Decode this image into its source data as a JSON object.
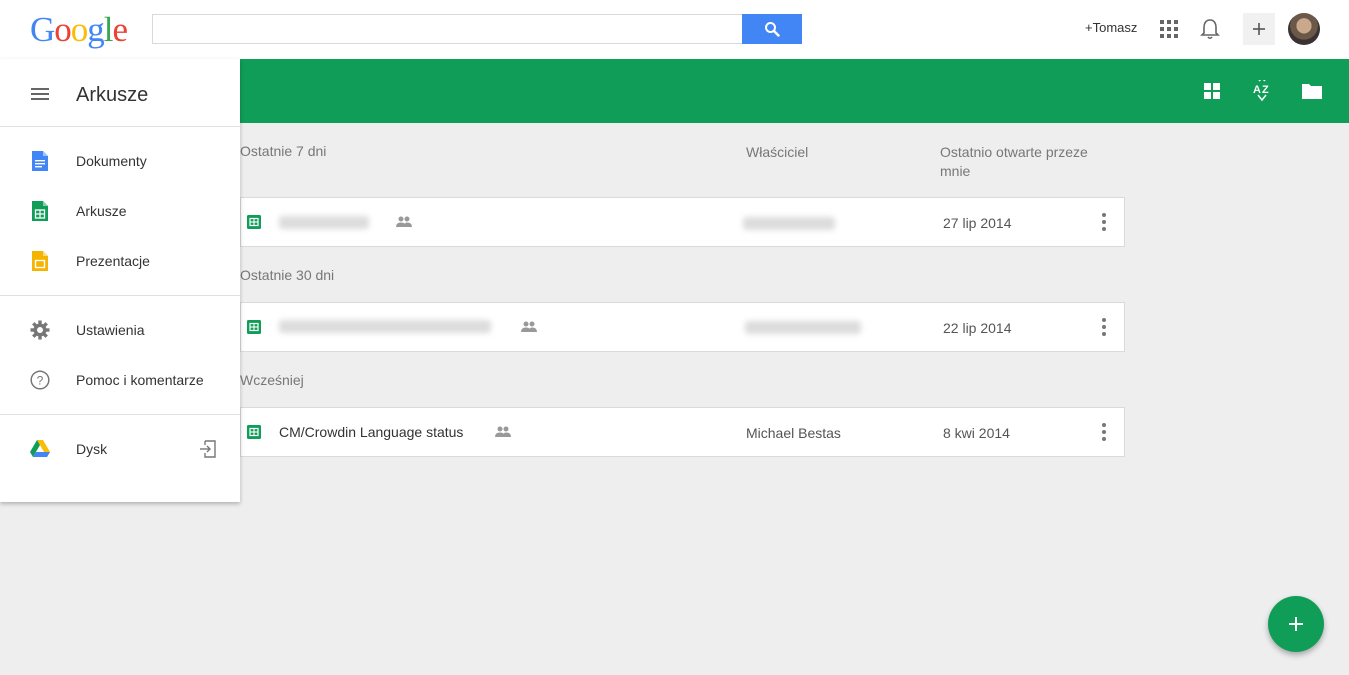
{
  "header": {
    "logo_letters": [
      "G",
      "o",
      "o",
      "g",
      "l",
      "e"
    ],
    "search_value": "",
    "user_link": "+Tomasz"
  },
  "drawer": {
    "title": "Arkusze",
    "apps": [
      {
        "label": "Dokumenty",
        "icon": "docs-icon",
        "color": "#4285f4"
      },
      {
        "label": "Arkusze",
        "icon": "sheets-icon",
        "color": "#0f9d58"
      },
      {
        "label": "Prezentacje",
        "icon": "slides-icon",
        "color": "#f4b400"
      }
    ],
    "settings": [
      {
        "label": "Ustawienia",
        "icon": "gear-icon"
      },
      {
        "label": "Pomoc i komentarze",
        "icon": "help-icon"
      }
    ],
    "drive": {
      "label": "Dysk",
      "icon": "drive-icon"
    }
  },
  "list": {
    "columns": {
      "owner": "Właściciel",
      "last_opened": "Ostatnio otwarte przeze mnie"
    },
    "groups": [
      {
        "title": "Ostatnie 7 dni",
        "rows": [
          {
            "name": "",
            "owner": "",
            "date": "27 lip 2014",
            "shared": true,
            "redacted": true
          }
        ]
      },
      {
        "title": "Ostatnie 30 dni",
        "rows": [
          {
            "name": "",
            "owner": "",
            "date": "22 lip 2014",
            "shared": true,
            "redacted": true
          }
        ]
      },
      {
        "title": "Wcześniej",
        "rows": [
          {
            "name": "CM/Crowdin Language status",
            "owner": "Michael Bestas",
            "date": "8 kwi 2014",
            "shared": true,
            "redacted": false
          }
        ]
      }
    ]
  },
  "colors": {
    "brand_green": "#0f9d58",
    "search_blue": "#4285f4",
    "background": "#eeeeee"
  }
}
